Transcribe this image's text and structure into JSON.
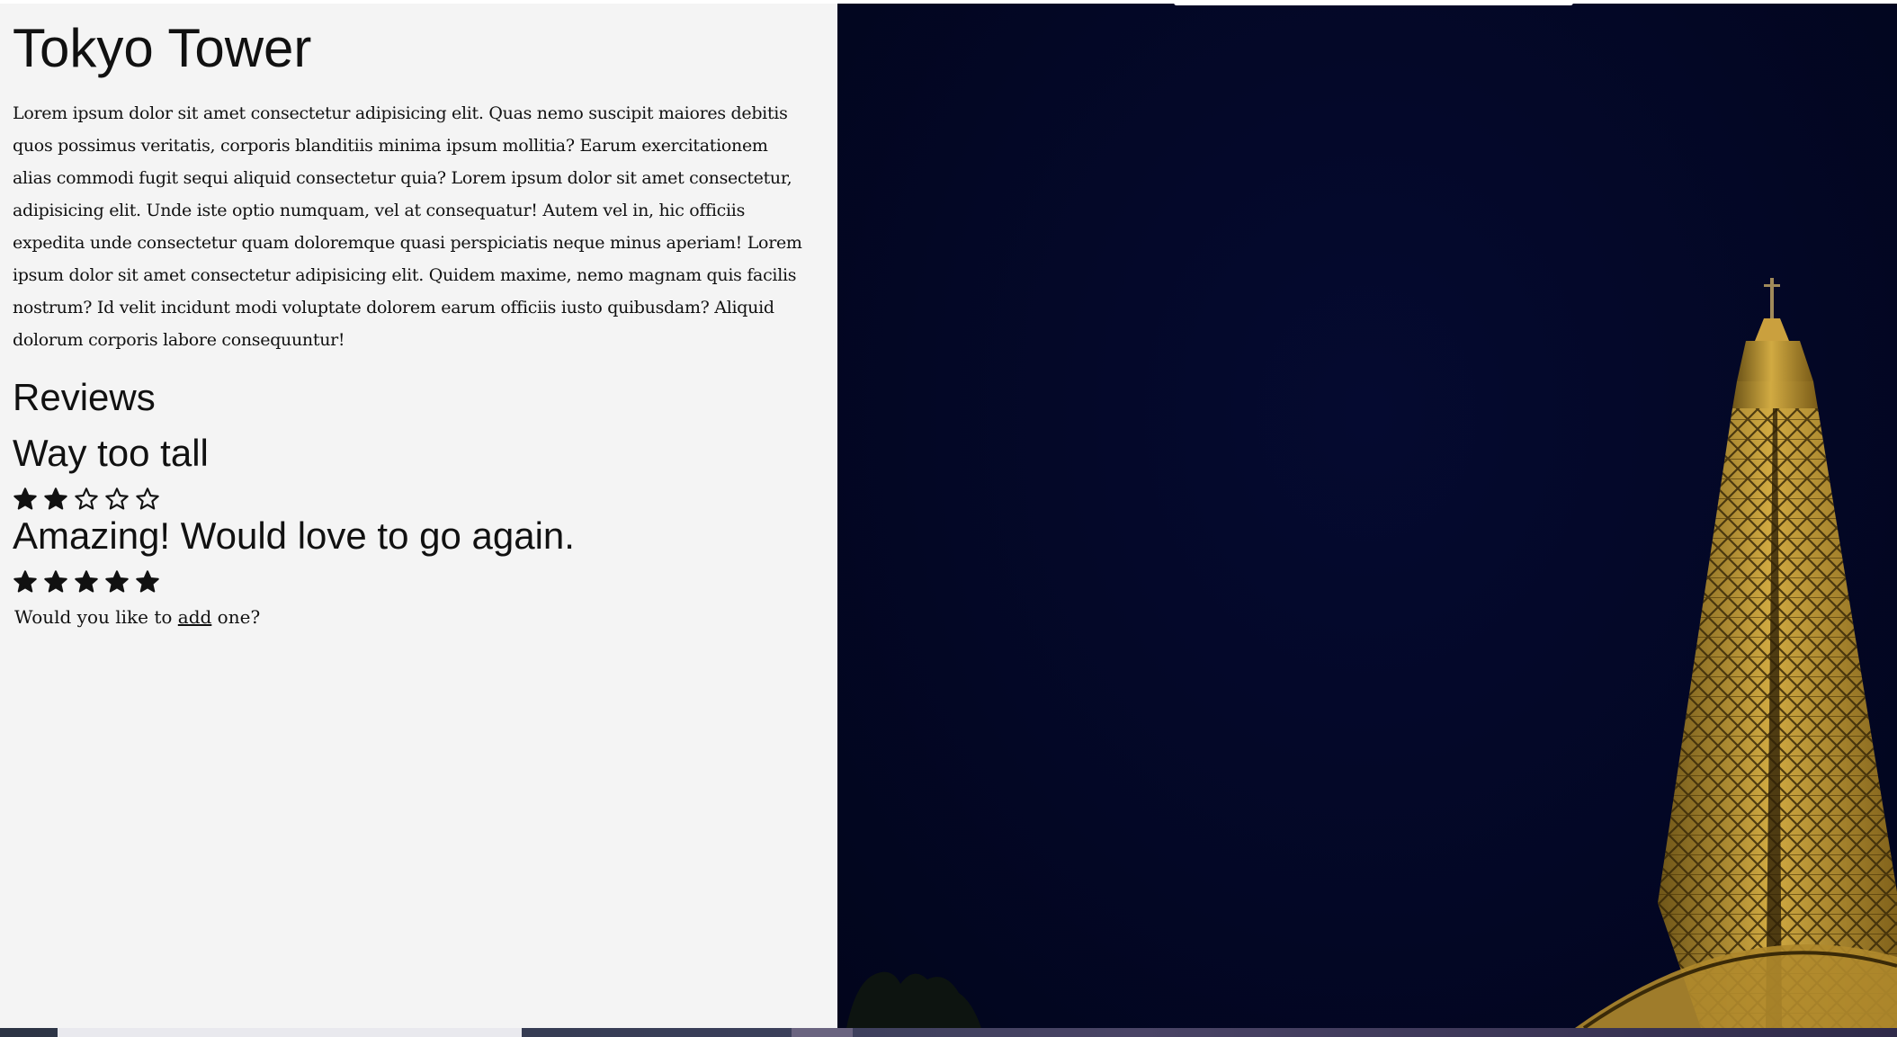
{
  "page": {
    "title": "Tokyo Tower",
    "description": "Lorem ipsum dolor sit amet consectetur adipisicing elit. Quas nemo suscipit maiores debitis quos possimus veritatis, corporis blanditiis minima ipsum mollitia? Earum exercitationem alias commodi fugit sequi aliquid consectetur quia? Lorem ipsum dolor sit amet consectetur, adipisicing elit. Unde iste optio numquam, vel at consequatur! Autem vel in, hic officiis expedita unde consectetur quam doloremque quasi perspiciatis neque minus aperiam! Lorem ipsum dolor sit amet consectetur adipisicing elit. Quidem maxime, nemo magnam quis facilis nostrum? Id velit incidunt modi voluptate dolorem earum officiis iusto quibusdam? Aliquid dolorum corporis labore consequuntur!"
  },
  "reviews": {
    "heading": "Reviews",
    "items": [
      {
        "title": "Way too tall",
        "rating": 2,
        "max_rating": 5
      },
      {
        "title": "Amazing! Would love to go again.",
        "rating": 5,
        "max_rating": 5
      }
    ]
  },
  "add_prompt": {
    "before": "Would you like to ",
    "link": "add",
    "after": " one?"
  },
  "icons": {
    "star_filled": "star-filled-icon",
    "star_empty": "star-empty-icon"
  },
  "colors": {
    "background": "#f4f4f4",
    "text": "#111111",
    "sky": "#030725",
    "tower_light": "#c9a23a"
  }
}
